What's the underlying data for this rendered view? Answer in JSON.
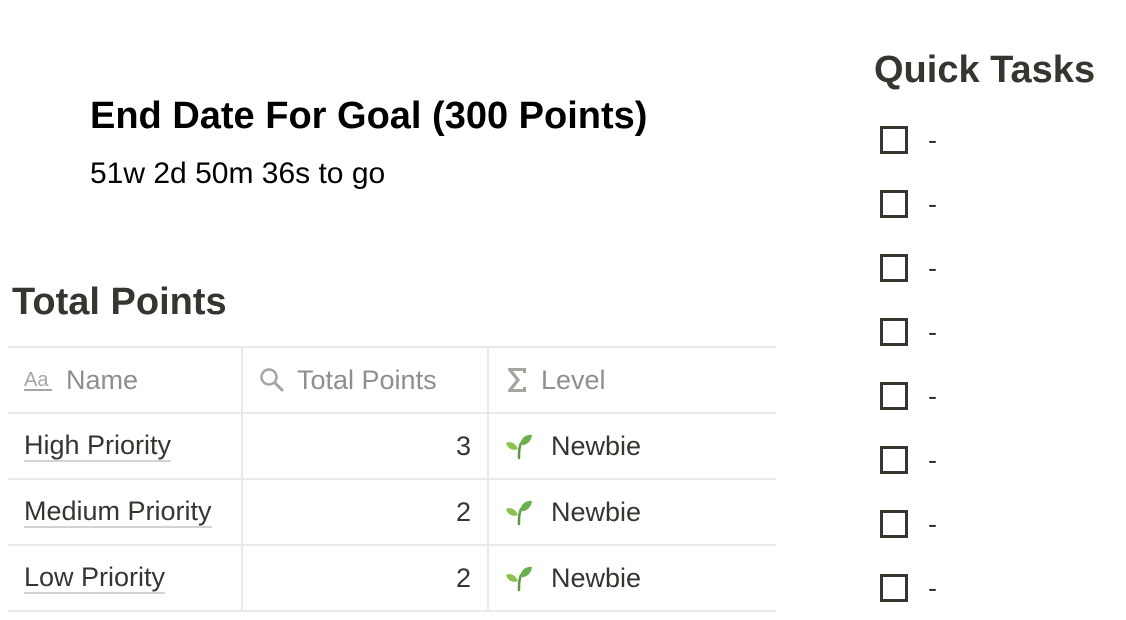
{
  "goal": {
    "title": "End Date For Goal (300 Points)",
    "countdown": "51w 2d 50m 36s to go"
  },
  "points": {
    "heading": "Total Points",
    "columns": [
      {
        "label": "Name",
        "icon": "text-aa-icon"
      },
      {
        "label": "Total Points",
        "icon": "search-icon"
      },
      {
        "label": "Level",
        "icon": "sigma-icon"
      }
    ],
    "rows": [
      {
        "name": "High Priority",
        "total": "3",
        "level": "Newbie",
        "level_icon": "seedling-icon"
      },
      {
        "name": "Medium Priority",
        "total": "2",
        "level": "Newbie",
        "level_icon": "seedling-icon"
      },
      {
        "name": "Low Priority",
        "total": "2",
        "level": "Newbie",
        "level_icon": "seedling-icon"
      }
    ]
  },
  "quick_tasks": {
    "heading": "Quick Tasks",
    "items": [
      {
        "label": "-",
        "checked": false
      },
      {
        "label": "-",
        "checked": false
      },
      {
        "label": "-",
        "checked": false
      },
      {
        "label": "-",
        "checked": false
      },
      {
        "label": "-",
        "checked": false
      },
      {
        "label": "-",
        "checked": false
      },
      {
        "label": "-",
        "checked": false
      },
      {
        "label": "-",
        "checked": false
      }
    ]
  },
  "colors": {
    "text": "#37352f",
    "muted": "#8e8e8a",
    "border": "#e9e9e7",
    "sprout_green": "#6ab04c"
  }
}
